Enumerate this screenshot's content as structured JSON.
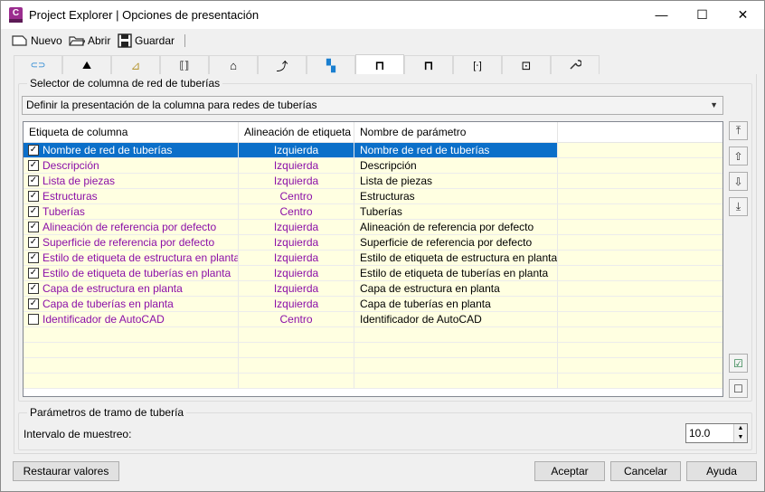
{
  "window": {
    "title": "Project Explorer | Opciones de presentación",
    "app_icon_letter": "C",
    "minimize": "—",
    "maximize": "☐",
    "close": "✕"
  },
  "toolbar": {
    "new_label": "Nuevo",
    "open_label": "Abrir",
    "save_label": "Guardar"
  },
  "tabs": [
    {
      "icon": "alignment-icon",
      "glyph": "⊂⊃",
      "active": false
    },
    {
      "icon": "profile-icon",
      "glyph": "⛰",
      "active": false
    },
    {
      "icon": "corridor-icon",
      "glyph": "⊿",
      "active": false
    },
    {
      "icon": "assembly-icon",
      "glyph": "⟦⟧",
      "active": false
    },
    {
      "icon": "surface-icon",
      "glyph": "⌂",
      "active": false
    },
    {
      "icon": "feature-line-icon",
      "glyph": "⤴",
      "active": false
    },
    {
      "icon": "pipe-network-icon",
      "glyph": "▚",
      "active": false
    },
    {
      "icon": "pipe-run-icon",
      "glyph": "⊓",
      "active": true
    },
    {
      "icon": "pressure-network-icon",
      "glyph": "⊓",
      "active": false
    },
    {
      "icon": "section-icon",
      "glyph": "[⋅]",
      "active": false
    },
    {
      "icon": "survey-icon",
      "glyph": "⊡",
      "active": false
    },
    {
      "icon": "settings-wrench-icon",
      "glyph": "🔧",
      "active": false
    }
  ],
  "column_selector": {
    "group_label": "Selector de columna de red de tuberías",
    "dropdown_value": "Definir la presentación de la columna para redes de tuberías"
  },
  "grid": {
    "headers": [
      "Etiqueta de columna",
      "Alineación de etiqueta",
      "Nombre de parámetro"
    ],
    "rows": [
      {
        "label": "Nombre de red de tuberías",
        "align": "Izquierda",
        "param": "Nombre de red de tuberías",
        "checked": true,
        "selected": true
      },
      {
        "label": "Descripción",
        "align": "Izquierda",
        "param": "Descripción",
        "checked": true,
        "selected": false
      },
      {
        "label": "Lista de piezas",
        "align": "Izquierda",
        "param": "Lista de piezas",
        "checked": true,
        "selected": false
      },
      {
        "label": "Estructuras",
        "align": "Centro",
        "param": "Estructuras",
        "checked": true,
        "selected": false
      },
      {
        "label": "Tuberías",
        "align": "Centro",
        "param": "Tuberías",
        "checked": true,
        "selected": false
      },
      {
        "label": "Alineación de referencia por defecto",
        "align": "Izquierda",
        "param": "Alineación de referencia por defecto",
        "checked": true,
        "selected": false
      },
      {
        "label": "Superficie de referencia por defecto",
        "align": "Izquierda",
        "param": "Superficie de referencia por defecto",
        "checked": true,
        "selected": false
      },
      {
        "label": "Estilo de etiqueta de estructura en planta",
        "align": "Izquierda",
        "param": "Estilo de etiqueta de estructura en planta",
        "checked": true,
        "selected": false
      },
      {
        "label": "Estilo de etiqueta de tuberías en planta",
        "align": "Izquierda",
        "param": "Estilo de etiqueta de tuberías en planta",
        "checked": true,
        "selected": false
      },
      {
        "label": "Capa de estructura en planta",
        "align": "Izquierda",
        "param": "Capa de estructura en planta",
        "checked": true,
        "selected": false
      },
      {
        "label": "Capa de tuberías en planta",
        "align": "Izquierda",
        "param": "Capa de tuberías en planta",
        "checked": true,
        "selected": false
      },
      {
        "label": "Identificador de AutoCAD",
        "align": "Centro",
        "param": "Identificador de AutoCAD",
        "checked": false,
        "selected": false
      }
    ]
  },
  "side_buttons": {
    "move_top": "⤒",
    "move_up": "⇧",
    "move_down": "⇩",
    "move_bottom": "⤓",
    "check_all": "☑",
    "uncheck_all": "☐"
  },
  "pipe_run_params": {
    "group_label": "Parámetros de tramo de tubería",
    "sampling_label": "Intervalo de muestreo:",
    "sampling_value": "10.0"
  },
  "footer": {
    "restore_label": "Restaurar valores",
    "accept_label": "Aceptar",
    "cancel_label": "Cancelar",
    "help_label": "Ayuda"
  }
}
